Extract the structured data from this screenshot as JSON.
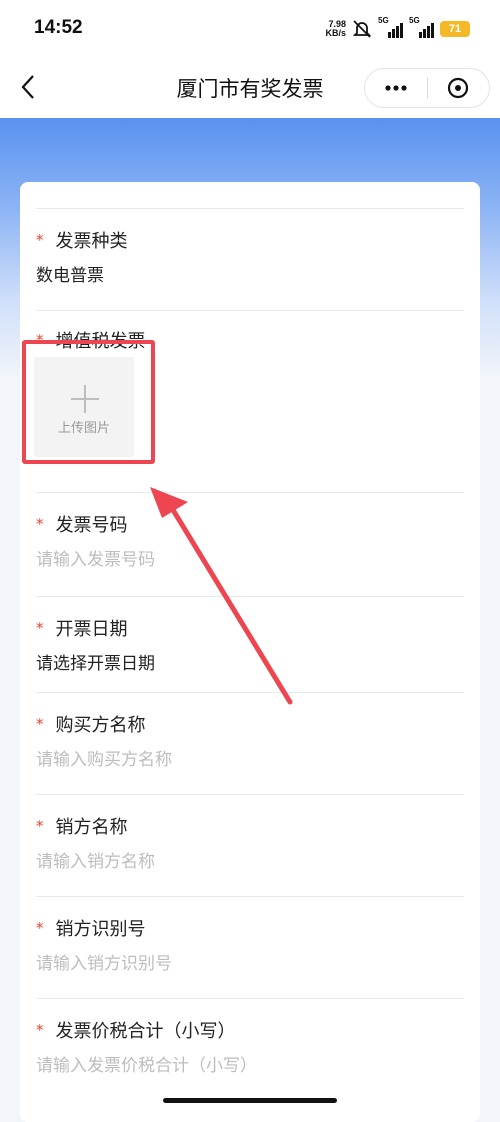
{
  "status": {
    "time": "14:52",
    "net_speed_value": "7.98",
    "net_speed_unit": "KB/s",
    "signal1_label": "5G",
    "signal2_label": "5G",
    "battery": "71"
  },
  "nav": {
    "title": "厦门市有奖发票"
  },
  "form": {
    "invoice_type": {
      "label": "发票种类",
      "value": "数电普票"
    },
    "vat_invoice": {
      "label": "增值税发票",
      "upload_label": "上传图片"
    },
    "invoice_number": {
      "label": "发票号码",
      "placeholder": "请输入发票号码"
    },
    "issue_date": {
      "label": "开票日期",
      "value": "请选择开票日期"
    },
    "buyer_name": {
      "label": "购买方名称",
      "placeholder": "请输入购买方名称"
    },
    "seller_name": {
      "label": "销方名称",
      "placeholder": "请输入销方名称"
    },
    "seller_tax_id": {
      "label": "销方识别号",
      "placeholder": "请输入销方识别号"
    },
    "total_amount": {
      "label": "发票价税合计（小写）",
      "placeholder": "请输入发票价税合计（小写）"
    }
  },
  "colors": {
    "required_star": "#e8462b",
    "annotation_red": "#ee4650",
    "header_blue": "#5a92f0"
  }
}
